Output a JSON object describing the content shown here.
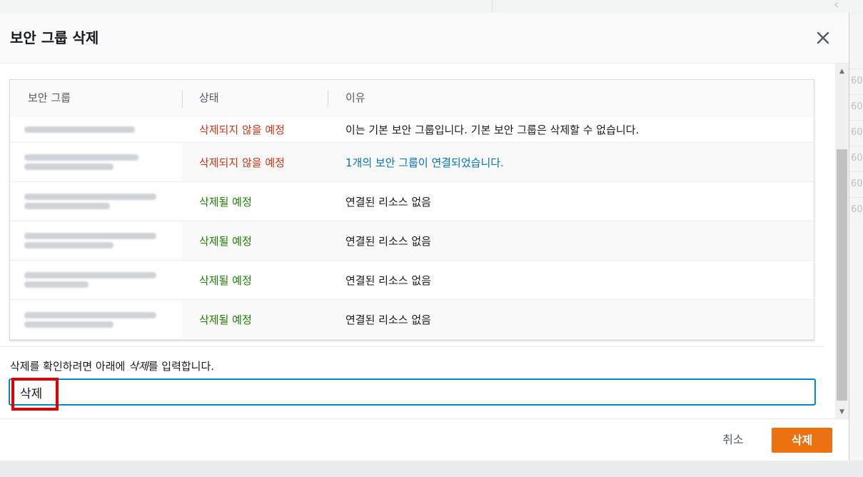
{
  "dialog": {
    "title": "보안 그룹 삭제",
    "close_icon": "close-icon"
  },
  "table": {
    "headers": [
      "보안 그룹",
      "상태",
      "이유"
    ],
    "rows": [
      {
        "name_blurred": true,
        "status": "삭제되지 않을 예정",
        "status_type": "error",
        "reason": "이는 기본 보안 그룹입니다. 기본 보안 그룹은 삭제할 수 없습니다.",
        "reason_is_link": false
      },
      {
        "name_blurred": true,
        "status": "삭제되지 않을 예정",
        "status_type": "error",
        "reason": "1개의 보안 그룹이 연결되었습니다.",
        "reason_is_link": true
      },
      {
        "name_blurred": true,
        "status": "삭제될 예정",
        "status_type": "success",
        "reason": "연결된 리소스 없음",
        "reason_is_link": false
      },
      {
        "name_blurred": true,
        "status": "삭제될 예정",
        "status_type": "success",
        "reason": "연결된 리소스 없음",
        "reason_is_link": false
      },
      {
        "name_blurred": true,
        "status": "삭제될 예정",
        "status_type": "success",
        "reason": "연결된 리소스 없음",
        "reason_is_link": false
      },
      {
        "name_blurred": true,
        "status": "삭제될 예정",
        "status_type": "success",
        "reason": "연결된 리소스 없음",
        "reason_is_link": false
      }
    ]
  },
  "confirm": {
    "label_before": "삭제를 확인하려면 아래에 ",
    "label_keyword": "삭제",
    "label_after": "를 입력합니다.",
    "input_value": "삭제"
  },
  "footer": {
    "cancel_label": "취소",
    "delete_label": "삭제"
  },
  "background": {
    "right_cells": [
      "60",
      "60",
      "60",
      "60",
      "60",
      "60"
    ]
  },
  "colors": {
    "error": "#d13212",
    "success": "#1d8102",
    "link": "#0073bb",
    "primary_button": "#ec7211",
    "highlight_box": "#e00000"
  }
}
